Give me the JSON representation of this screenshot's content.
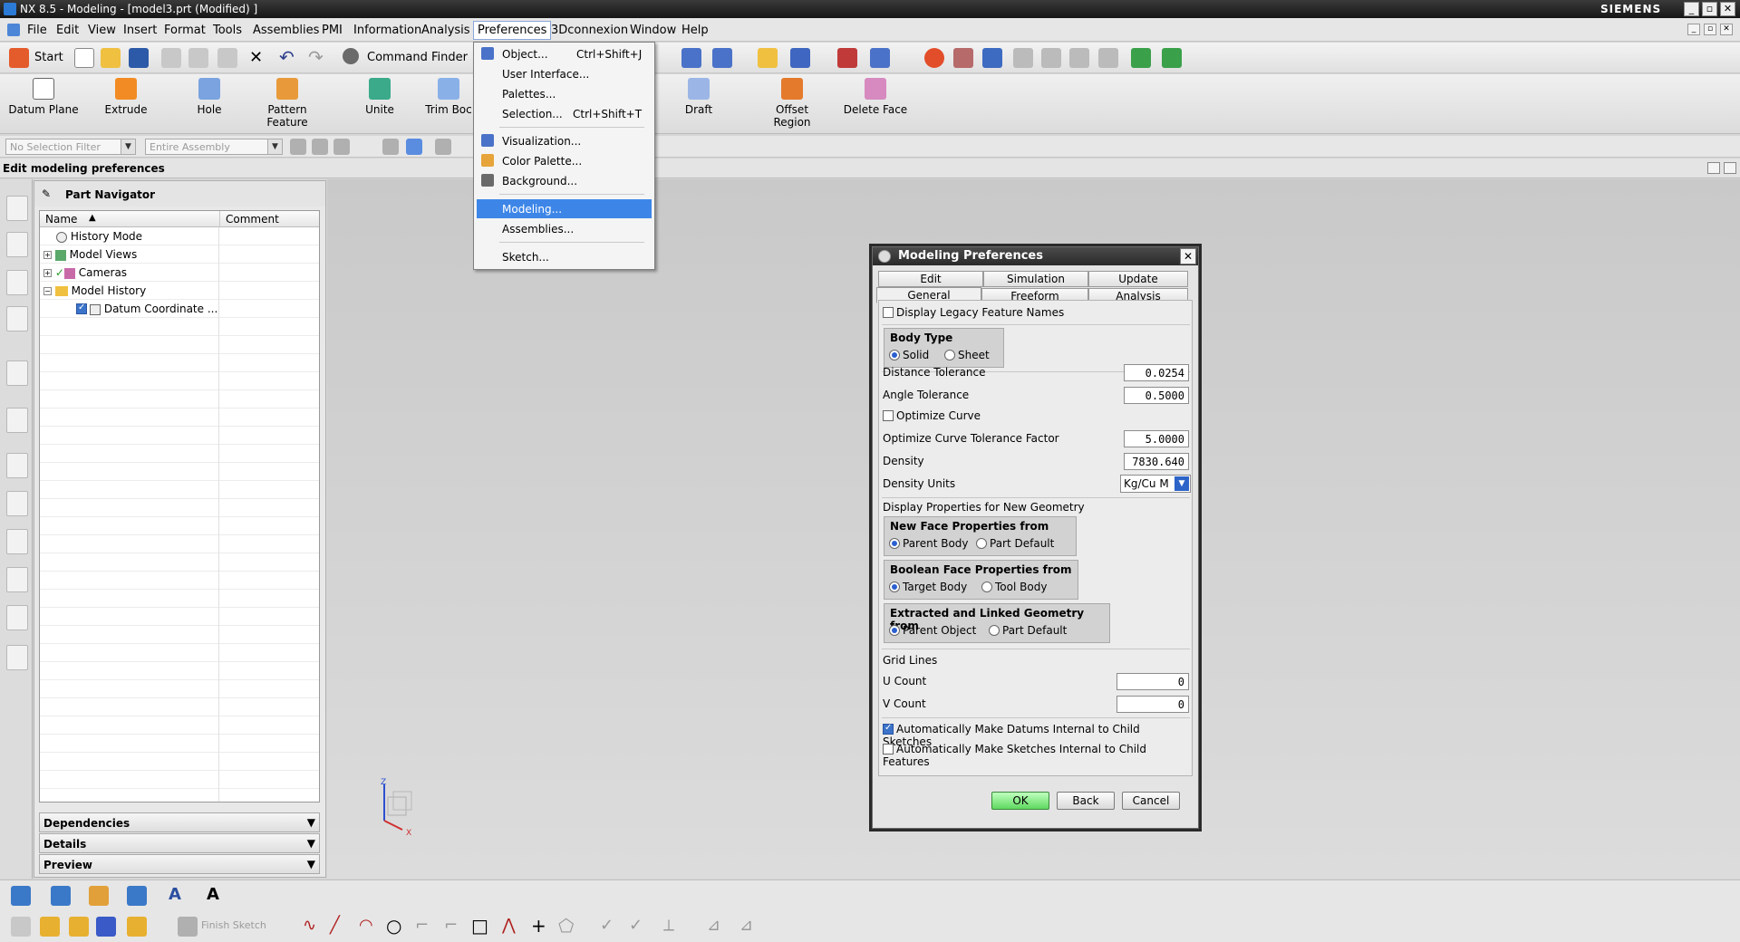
{
  "window": {
    "title": "NX 8.5 - Modeling - [model3.prt (Modified) ]",
    "brand": "SIEMENS"
  },
  "menubar": {
    "items": [
      "File",
      "Edit",
      "View",
      "Insert",
      "Format",
      "Tools",
      "Assemblies",
      "PMI",
      "Information",
      "Analysis",
      "Preferences",
      "3Dconnexion",
      "Window",
      "Help"
    ],
    "active": "Preferences"
  },
  "toolbar1": {
    "start_label": "Start",
    "command_finder_label": "Command Finder"
  },
  "toolbar2": {
    "buttons": [
      "Datum Plane",
      "Extrude",
      "Hole",
      "Pattern Feature",
      "Unite",
      "Trim Boc",
      "Draft",
      "Offset Region",
      "Delete Face"
    ]
  },
  "selection_bar": {
    "filter_placeholder": "No Selection Filter",
    "scope_placeholder": "Entire Assembly"
  },
  "cue_line": "Edit modeling preferences",
  "part_navigator": {
    "title": "Part Navigator",
    "columns": [
      "Name",
      "Comment"
    ],
    "rows": [
      {
        "label": "History Mode"
      },
      {
        "label": "Model Views"
      },
      {
        "label": "Cameras"
      },
      {
        "label": "Model History"
      },
      {
        "label": "Datum Coordinate ..."
      }
    ],
    "panels": [
      "Dependencies",
      "Details",
      "Preview"
    ]
  },
  "preferences_menu": {
    "items": [
      {
        "label": "Object...",
        "shortcut": "Ctrl+Shift+J"
      },
      {
        "label": "User Interface...",
        "shortcut": ""
      },
      {
        "label": "Palettes...",
        "shortcut": ""
      },
      {
        "label": "Selection...",
        "shortcut": "Ctrl+Shift+T"
      },
      {
        "label": "Visualization...",
        "shortcut": ""
      },
      {
        "label": "Color Palette...",
        "shortcut": ""
      },
      {
        "label": "Background...",
        "shortcut": ""
      },
      {
        "label": "Modeling...",
        "shortcut": ""
      },
      {
        "label": "Assemblies...",
        "shortcut": ""
      },
      {
        "label": "Sketch...",
        "shortcut": ""
      }
    ],
    "highlighted": "Modeling..."
  },
  "dialog": {
    "title": "Modeling Preferences",
    "tabs_back": [
      "Edit",
      "Simulation",
      "Update"
    ],
    "tabs_front": [
      "General",
      "Freeform",
      "Analysis"
    ],
    "selected_tab": "General",
    "legacy_names_label": "Display Legacy Feature Names",
    "legacy_names_checked": false,
    "body_type": {
      "title": "Body Type",
      "options": [
        "Solid",
        "Sheet"
      ],
      "selected": "Solid"
    },
    "distance_tolerance": {
      "label": "Distance Tolerance",
      "value": "0.0254"
    },
    "angle_tolerance": {
      "label": "Angle Tolerance",
      "value": "0.5000"
    },
    "optimize_curve": {
      "label": "Optimize Curve",
      "checked": false
    },
    "optimize_factor": {
      "label": "Optimize Curve Tolerance Factor",
      "value": "5.0000"
    },
    "density": {
      "label": "Density",
      "value": "7830.640"
    },
    "density_units": {
      "label": "Density Units",
      "value": "Kg/Cu M"
    },
    "display_props_label": "Display Properties for New Geometry",
    "new_face": {
      "title": "New Face Properties from",
      "options": [
        "Parent Body",
        "Part Default"
      ],
      "selected": "Parent Body"
    },
    "boolean_face": {
      "title": "Boolean Face Properties from",
      "options": [
        "Target Body",
        "Tool Body"
      ],
      "selected": "Target Body"
    },
    "extracted": {
      "title": "Extracted and Linked Geometry from",
      "options": [
        "Parent Object",
        "Part Default"
      ],
      "selected": "Parent Object"
    },
    "grid_lines_label": "Grid Lines",
    "u_count": {
      "label": "U Count",
      "value": "0"
    },
    "v_count": {
      "label": "V Count",
      "value": "0"
    },
    "auto_datums": {
      "label": "Automatically Make Datums Internal to Child Sketches",
      "checked": true
    },
    "auto_sketches": {
      "label": "Automatically Make Sketches Internal to Child Features",
      "checked": false
    },
    "buttons": {
      "ok": "OK",
      "back": "Back",
      "cancel": "Cancel"
    }
  },
  "bottom_toolbar": {
    "finish_sketch_label": "Finish Sketch"
  },
  "colors": {
    "menu_highlight": "#3d86e8",
    "ok_button": "#5fd95f",
    "title_bar": "#1f1f1f"
  }
}
